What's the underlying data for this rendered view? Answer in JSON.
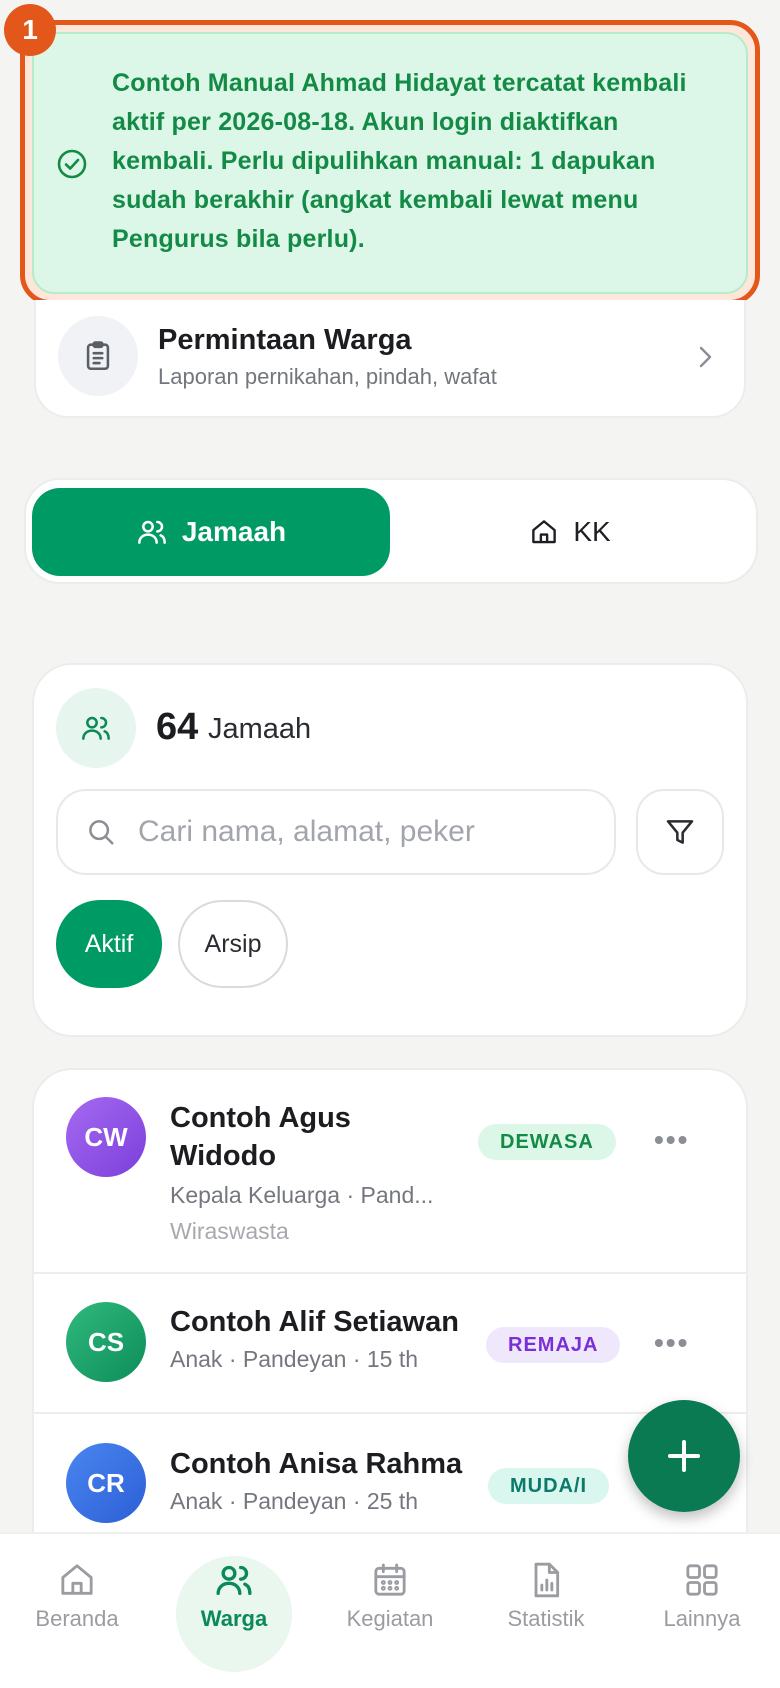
{
  "toast": {
    "badge": "1",
    "message": "Contoh Manual Ahmad Hidayat tercatat kembali aktif per 2026-08-18. Akun login diaktifkan kembali. Perlu dipulihkan manual: 1 dapukan sudah berakhir (angkat kembali lewat menu Pengurus bila perlu).",
    "icon": "check-circle-icon",
    "accent": "#138a46"
  },
  "request_card": {
    "title": "Permintaan Warga",
    "subtitle": "Laporan pernikahan, pindah, wafat",
    "icon": "clipboard-icon"
  },
  "segments": [
    {
      "label": "Jamaah",
      "icon": "users-icon",
      "active": true
    },
    {
      "label": "KK",
      "icon": "home-icon",
      "active": false
    }
  ],
  "summary": {
    "count": "64",
    "count_label": "Jamaah",
    "search_placeholder": "Cari nama, alamat, peker",
    "filters": [
      {
        "label": "Aktif",
        "active": true
      },
      {
        "label": "Arsip",
        "active": false
      }
    ]
  },
  "members": [
    {
      "initials": "CW",
      "name": "Contoh Agus Widodo",
      "meta": "Kepala Keluarga · Pand...",
      "meta2": "Wiraswasta",
      "tag": "DEWASA",
      "avatar_color": "#8b4fe0",
      "tag_bg": "#dcf7e7",
      "tag_color": "#138a46"
    },
    {
      "initials": "CS",
      "name": "Contoh Alif Setiawan",
      "meta": "Anak · Pandeyan · 15 th",
      "meta2": "",
      "tag": "REMAJA",
      "avatar_color": "#17a06a",
      "tag_bg": "#efe8fc",
      "tag_color": "#7b2fd6"
    },
    {
      "initials": "CR",
      "name": "Contoh Anisa Rahma",
      "meta": "Anak · Pandeyan · 25 th",
      "meta2": "",
      "tag": "MUDA/I",
      "avatar_color": "#2f6fe4",
      "tag_bg": "#d9f6ef",
      "tag_color": "#0c7a6a"
    }
  ],
  "nav": [
    {
      "label": "Beranda",
      "icon": "home-icon",
      "active": false
    },
    {
      "label": "Warga",
      "icon": "users-icon",
      "active": true
    },
    {
      "label": "Kegiatan",
      "icon": "calendar-icon",
      "active": false
    },
    {
      "label": "Statistik",
      "icon": "chart-file-icon",
      "active": false
    },
    {
      "label": "Lainnya",
      "icon": "grid-icon",
      "active": false
    }
  ],
  "colors": {
    "primary": "#009a64",
    "toast_border": "#e4571a"
  }
}
